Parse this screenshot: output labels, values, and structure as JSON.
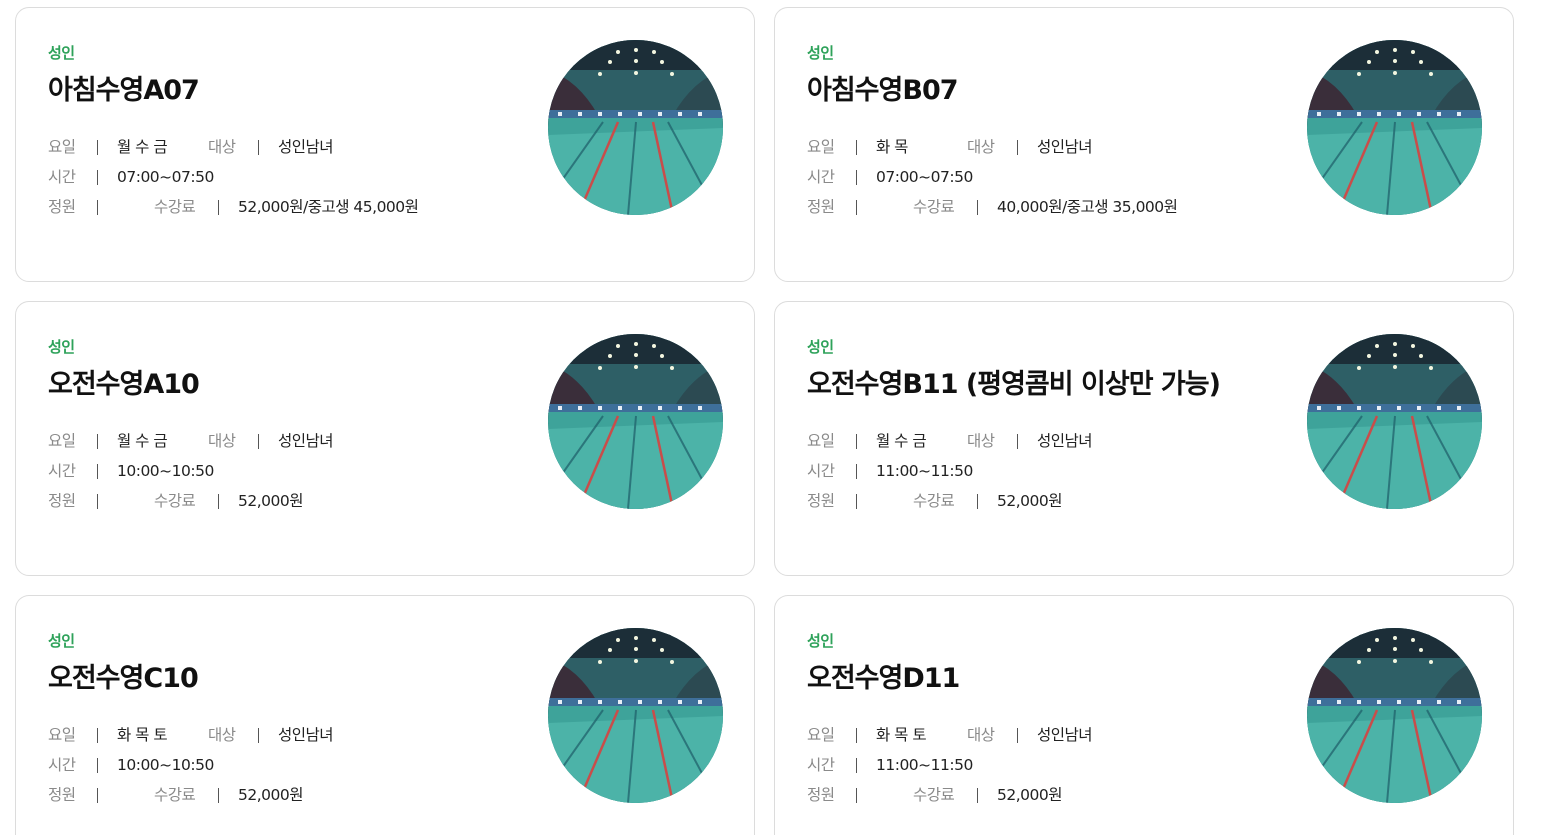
{
  "cards": [
    {
      "category": "성인",
      "title": "아침수영A07",
      "label_day": "요일",
      "day": "월 수 금",
      "label_target": "대상",
      "target": "성인남녀",
      "label_time": "시간",
      "time": "07:00~07:50",
      "label_capacity": "정원",
      "label_fee": "수강료",
      "fee": "52,000원/중고생 45,000원",
      "image_icon": "pool-photo"
    },
    {
      "category": "성인",
      "title": "아침수영B07",
      "label_day": "요일",
      "day": "화 목",
      "label_target": "대상",
      "target": "성인남녀",
      "label_time": "시간",
      "time": "07:00~07:50",
      "label_capacity": "정원",
      "label_fee": "수강료",
      "fee": "40,000원/중고생 35,000원",
      "image_icon": "pool-photo"
    },
    {
      "category": "성인",
      "title": "오전수영A10",
      "label_day": "요일",
      "day": "월 수 금",
      "label_target": "대상",
      "target": "성인남녀",
      "label_time": "시간",
      "time": "10:00~10:50",
      "label_capacity": "정원",
      "label_fee": "수강료",
      "fee": "52,000원",
      "image_icon": "pool-photo"
    },
    {
      "category": "성인",
      "title": "오전수영B11 (평영콤비 이상만 가능)",
      "label_day": "요일",
      "day": "월 수 금",
      "label_target": "대상",
      "target": "성인남녀",
      "label_time": "시간",
      "time": "11:00~11:50",
      "label_capacity": "정원",
      "label_fee": "수강료",
      "fee": "52,000원",
      "image_icon": "pool-photo"
    },
    {
      "category": "성인",
      "title": "오전수영C10",
      "label_day": "요일",
      "day": "화 목 토",
      "label_target": "대상",
      "target": "성인남녀",
      "label_time": "시간",
      "time": "10:00~10:50",
      "label_capacity": "정원",
      "label_fee": "수강료",
      "fee": "52,000원",
      "image_icon": "pool-photo"
    },
    {
      "category": "성인",
      "title": "오전수영D11",
      "label_day": "요일",
      "day": "화 목 토",
      "label_target": "대상",
      "target": "성인남녀",
      "label_time": "시간",
      "time": "11:00~11:50",
      "label_capacity": "정원",
      "label_fee": "수강료",
      "fee": "52,000원",
      "image_icon": "pool-photo"
    }
  ],
  "colors": {
    "category": "#2ea25a",
    "label": "#8a8a8a",
    "border": "#dcdcdc"
  }
}
